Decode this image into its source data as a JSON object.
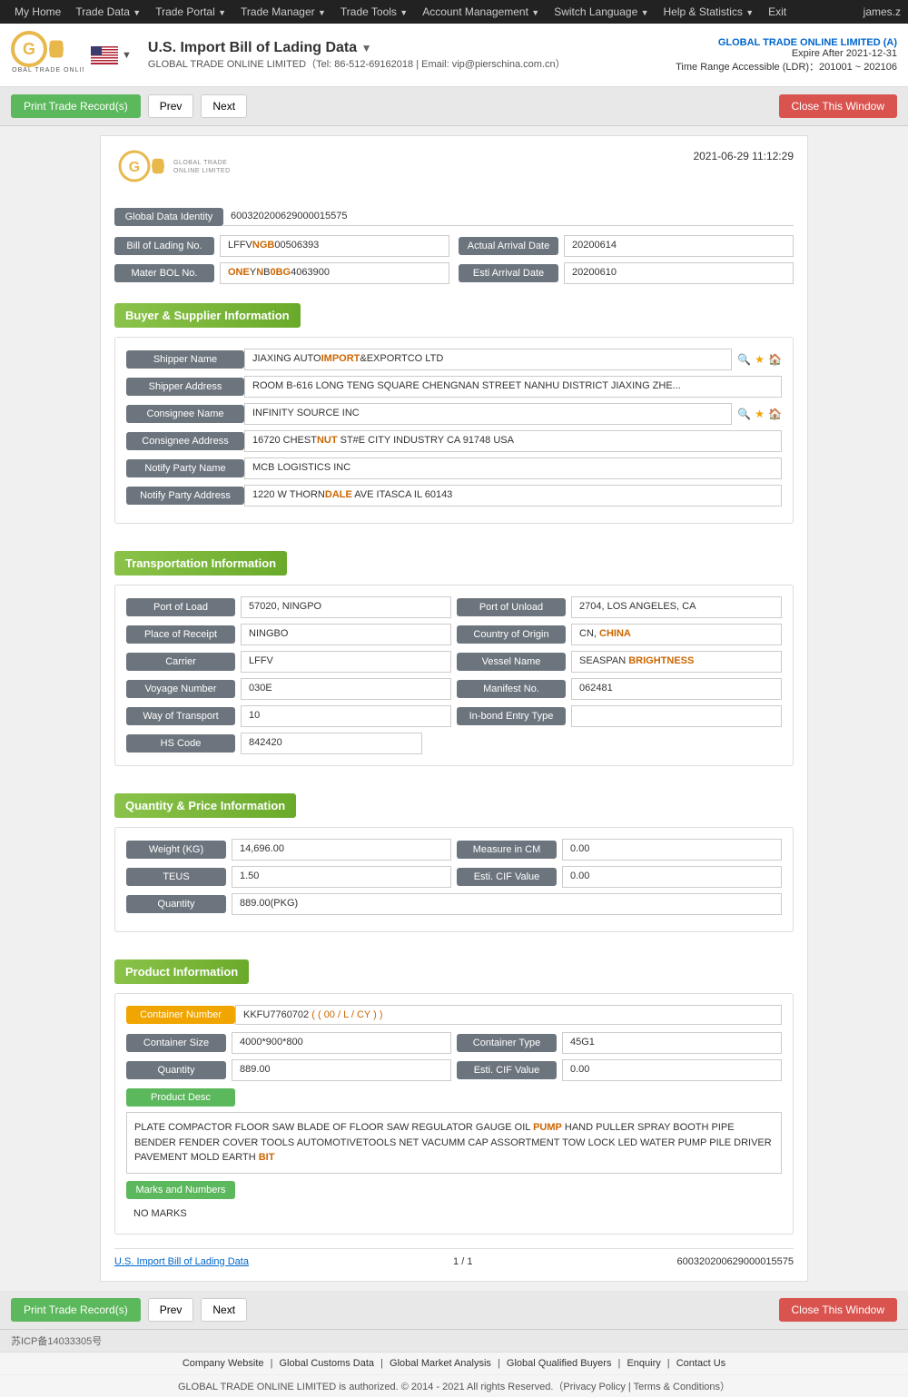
{
  "topnav": {
    "items": [
      "My Home",
      "Trade Data",
      "Trade Portal",
      "Trade Manager",
      "Trade Tools",
      "Account Management",
      "Switch Language",
      "Help & Statistics",
      "Exit"
    ],
    "user": "james.z"
  },
  "header": {
    "title": "U.S. Import Bill of Lading Data",
    "subtitle": "GLOBAL TRADE ONLINE LIMITED（Tel: 86-512-69162018 | Email: vip@pierschina.com.cn）",
    "company": "GLOBAL TRADE ONLINE LIMITED (A)",
    "expire": "Expire After 2021-12-31",
    "range": "Time Range Accessible (LDR)：201001 ~ 202106"
  },
  "toolbar": {
    "print_label": "Print Trade Record(s)",
    "prev_label": "Prev",
    "next_label": "Next",
    "close_label": "Close This Window"
  },
  "record": {
    "datetime": "2021-06-29 11:12:29",
    "global_data_identity_label": "Global Data Identity",
    "global_data_identity_value": "600320200629000015575",
    "bill_of_lading_no_label": "Bill of Lading No.",
    "bill_of_lading_no_value": "LFFVNGB00506393",
    "bill_of_lading_no_highlight": [
      "NGB"
    ],
    "actual_arrival_date_label": "Actual Arrival Date",
    "actual_arrival_date_value": "20200614",
    "mater_bol_no_label": "Mater BOL No.",
    "mater_bol_no_value": "ONEYNB0BG4063900",
    "mater_bol_no_highlight": [
      "ONE",
      "0BG",
      "00"
    ],
    "esti_arrival_date_label": "Esti Arrival Date",
    "esti_arrival_date_value": "20200610"
  },
  "buyer_supplier": {
    "section_title": "Buyer & Supplier Information",
    "shipper_name_label": "Shipper Name",
    "shipper_name_value": "JIAXING AUTOIMPORT&EXPORTCO LTD",
    "shipper_name_highlight": [
      "IMPORT"
    ],
    "shipper_address_label": "Shipper Address",
    "shipper_address_value": "ROOM B-616 LONG TENG SQUARE CHENGNAN STREET NANHU DISTRICT JIAXING ZHE...",
    "consignee_name_label": "Consignee Name",
    "consignee_name_value": "INFINITY SOURCE INC",
    "consignee_address_label": "Consignee Address",
    "consignee_address_value": "16720 CHESTNUT ST#E CITY INDUSTRY CA 91748 USA",
    "consignee_address_highlight": [
      "NUT"
    ],
    "notify_party_name_label": "Notify Party Name",
    "notify_party_name_value": "MCB LOGISTICS INC",
    "notify_party_address_label": "Notify Party Address",
    "notify_party_address_value": "1220 W THORNDALE AVE ITASCA IL 60143",
    "notify_party_address_highlight": [
      "DALE"
    ]
  },
  "transportation": {
    "section_title": "Transportation Information",
    "port_of_load_label": "Port of Load",
    "port_of_load_value": "57020, NINGPO",
    "port_of_unload_label": "Port of Unload",
    "port_of_unload_value": "2704, LOS ANGELES, CA",
    "place_of_receipt_label": "Place of Receipt",
    "place_of_receipt_value": "NINGBO",
    "country_of_origin_label": "Country of Origin",
    "country_of_origin_value": "CN, CHINA",
    "country_of_origin_highlight": [
      "CHINA"
    ],
    "carrier_label": "Carrier",
    "carrier_value": "LFFV",
    "vessel_name_label": "Vessel Name",
    "vessel_name_value": "SEASPAN BRIGHTNESS",
    "vessel_name_highlight": [
      "BRIGHTNESS"
    ],
    "voyage_number_label": "Voyage Number",
    "voyage_number_value": "030E",
    "manifest_no_label": "Manifest No.",
    "manifest_no_value": "062481",
    "way_of_transport_label": "Way of Transport",
    "way_of_transport_value": "10",
    "in_bond_entry_type_label": "In-bond Entry Type",
    "in_bond_entry_type_value": "",
    "hs_code_label": "HS Code",
    "hs_code_value": "842420"
  },
  "quantity_price": {
    "section_title": "Quantity & Price Information",
    "weight_kg_label": "Weight (KG)",
    "weight_kg_value": "14,696.00",
    "measure_in_cm_label": "Measure in CM",
    "measure_in_cm_value": "0.00",
    "teus_label": "TEUS",
    "teus_value": "1.50",
    "esti_cif_value_label": "Esti. CIF Value",
    "esti_cif_value_value": "0.00",
    "quantity_label": "Quantity",
    "quantity_value": "889.00(PKG)"
  },
  "product_information": {
    "section_title": "Product Information",
    "container_number_label": "Container Number",
    "container_number_value": "KKFU7760702",
    "container_number_suffix": "( 00 / L / CY )",
    "container_size_label": "Container Size",
    "container_size_value": "4000*900*800",
    "container_type_label": "Container Type",
    "container_type_value": "45G1",
    "quantity_label": "Quantity",
    "quantity_value": "889.00",
    "esti_cif_value_label": "Esti. CIF Value",
    "esti_cif_value_value": "0.00",
    "product_desc_label": "Product Desc",
    "product_desc_text": "PLATE COMPACTOR FLOOR SAW BLADE OF FLOOR SAW REGULATOR GAUGE OIL PUMP HAND PULLER SPRAY BOOTH PIPE BENDER FENDER COVER TOOLS AUTOMOTIVETOOLS NET VACUMM CAP ASSORTMENT TOW LOCK LED WATER PUMP PILE DRIVER PAVEMENT MOLD EARTH BIT",
    "product_desc_highlight": [
      "PUMP",
      "BIT"
    ],
    "marks_label": "Marks and Numbers",
    "marks_value": "NO MARKS"
  },
  "record_footer": {
    "title": "U.S. Import Bill of Lading Data",
    "pagination": "1 / 1",
    "record_id": "600320200629000015575"
  },
  "bottom_toolbar": {
    "print_label": "Print Trade Record(s)",
    "prev_label": "Prev",
    "next_label": "Next",
    "close_label": "Close This Window"
  },
  "footer": {
    "links": [
      "Company Website",
      "Global Customs Data",
      "Global Market Analysis",
      "Global Qualified Buyers",
      "Enquiry",
      "Contact Us"
    ],
    "copyright": "GLOBAL TRADE ONLINE LIMITED is authorized. © 2014 - 2021 All rights Reserved.（Privacy Policy | Terms & Conditions）",
    "icp": "苏ICP备14033305号"
  }
}
